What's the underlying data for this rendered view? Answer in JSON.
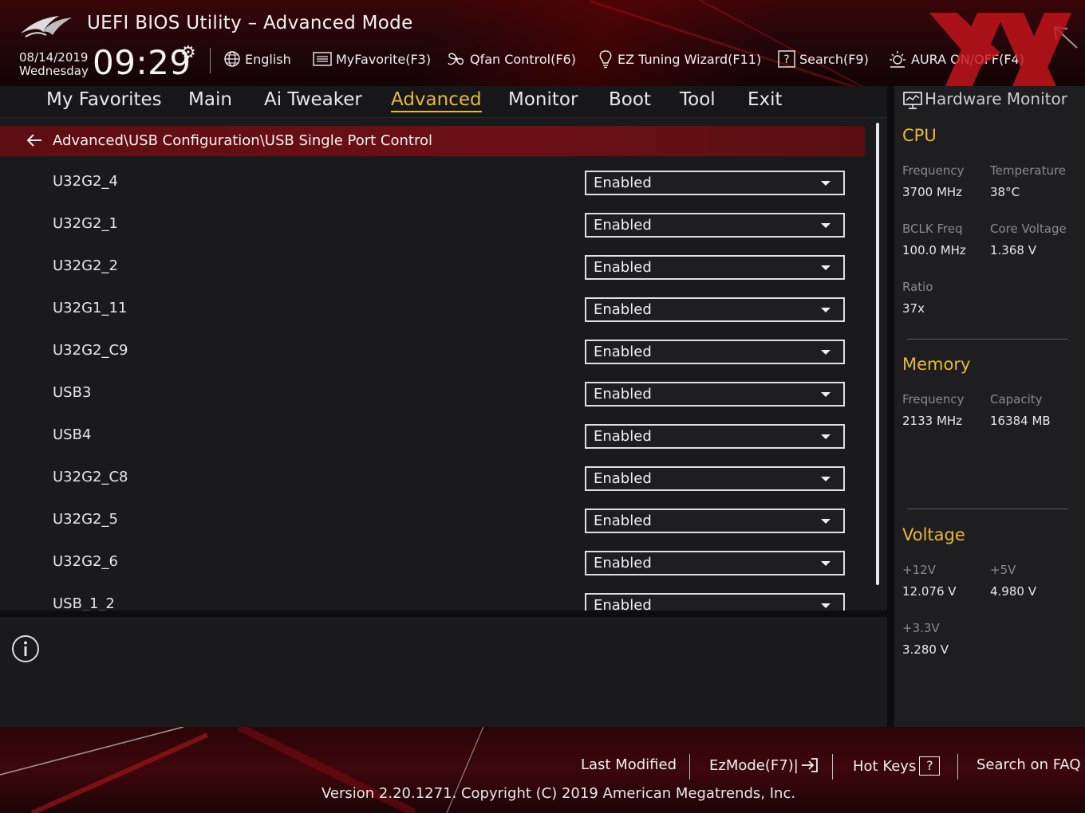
{
  "header": {
    "title": "UEFI BIOS Utility – Advanced Mode",
    "date": "08/14/2019",
    "weekday": "Wednesday",
    "time": "09:29",
    "tools": {
      "language": "English",
      "myfavorite": "MyFavorite(F3)",
      "qfan": "Qfan Control(F6)",
      "ez_tuning": "EZ Tuning Wizard(F11)",
      "search": "Search(F9)",
      "aura": "AURA ON/OFF(F4)"
    }
  },
  "nav": {
    "tabs": [
      "My Favorites",
      "Main",
      "Ai Tweaker",
      "Advanced",
      "Monitor",
      "Boot",
      "Tool",
      "Exit"
    ],
    "active": "Advanced"
  },
  "main": {
    "breadcrumb": "Advanced\\USB Configuration\\USB Single Port Control",
    "rows": [
      {
        "label": "U32G2_4",
        "value": "Enabled"
      },
      {
        "label": "U32G2_1",
        "value": "Enabled"
      },
      {
        "label": "U32G2_2",
        "value": "Enabled"
      },
      {
        "label": "U32G1_11",
        "value": "Enabled"
      },
      {
        "label": "U32G2_C9",
        "value": "Enabled"
      },
      {
        "label": "USB3",
        "value": "Enabled"
      },
      {
        "label": "USB4",
        "value": "Enabled"
      },
      {
        "label": "U32G2_C8",
        "value": "Enabled"
      },
      {
        "label": "U32G2_5",
        "value": "Enabled"
      },
      {
        "label": "U32G2_6",
        "value": "Enabled"
      },
      {
        "label": "USB_1_2",
        "value": "Enabled"
      }
    ]
  },
  "hardware_monitor": {
    "title": "Hardware Monitor",
    "cpu": {
      "heading": "CPU",
      "frequency_label": "Frequency",
      "frequency": "3700 MHz",
      "temperature_label": "Temperature",
      "temperature": "38°C",
      "bclk_label": "BCLK Freq",
      "bclk": "100.0 MHz",
      "core_voltage_label": "Core Voltage",
      "core_voltage": "1.368 V",
      "ratio_label": "Ratio",
      "ratio": "37x"
    },
    "memory": {
      "heading": "Memory",
      "frequency_label": "Frequency",
      "frequency": "2133 MHz",
      "capacity_label": "Capacity",
      "capacity": "16384 MB"
    },
    "voltage": {
      "heading": "Voltage",
      "v12_label": "+12V",
      "v12": "12.076 V",
      "v5_label": "+5V",
      "v5": "4.980 V",
      "v33_label": "+3.3V",
      "v33": "3.280 V"
    }
  },
  "footer": {
    "last_modified": "Last Modified",
    "ezmode": "EzMode(F7)|",
    "hotkeys": "Hot Keys",
    "hotkeys_key": "?",
    "faq": "Search on FAQ",
    "copyright": "Version 2.20.1271. Copyright (C) 2019 American Megatrends, Inc."
  },
  "colors": {
    "accent": "#e8b83a",
    "breadcrumb_bar": "#6d1016",
    "panel": "#1a1a1c"
  },
  "icons": {
    "clock_settings": "gear-icon",
    "language": "globe-icon",
    "myfavorite": "favorite-list-icon",
    "qfan": "fan-icon",
    "ez_tuning": "lightbulb-icon",
    "search": "question-box-icon",
    "aura": "aura-light-icon",
    "back": "back-arrow-icon",
    "info": "info-icon",
    "hw_monitor": "monitor-icon",
    "ezmode": "exit-arrow-icon"
  }
}
